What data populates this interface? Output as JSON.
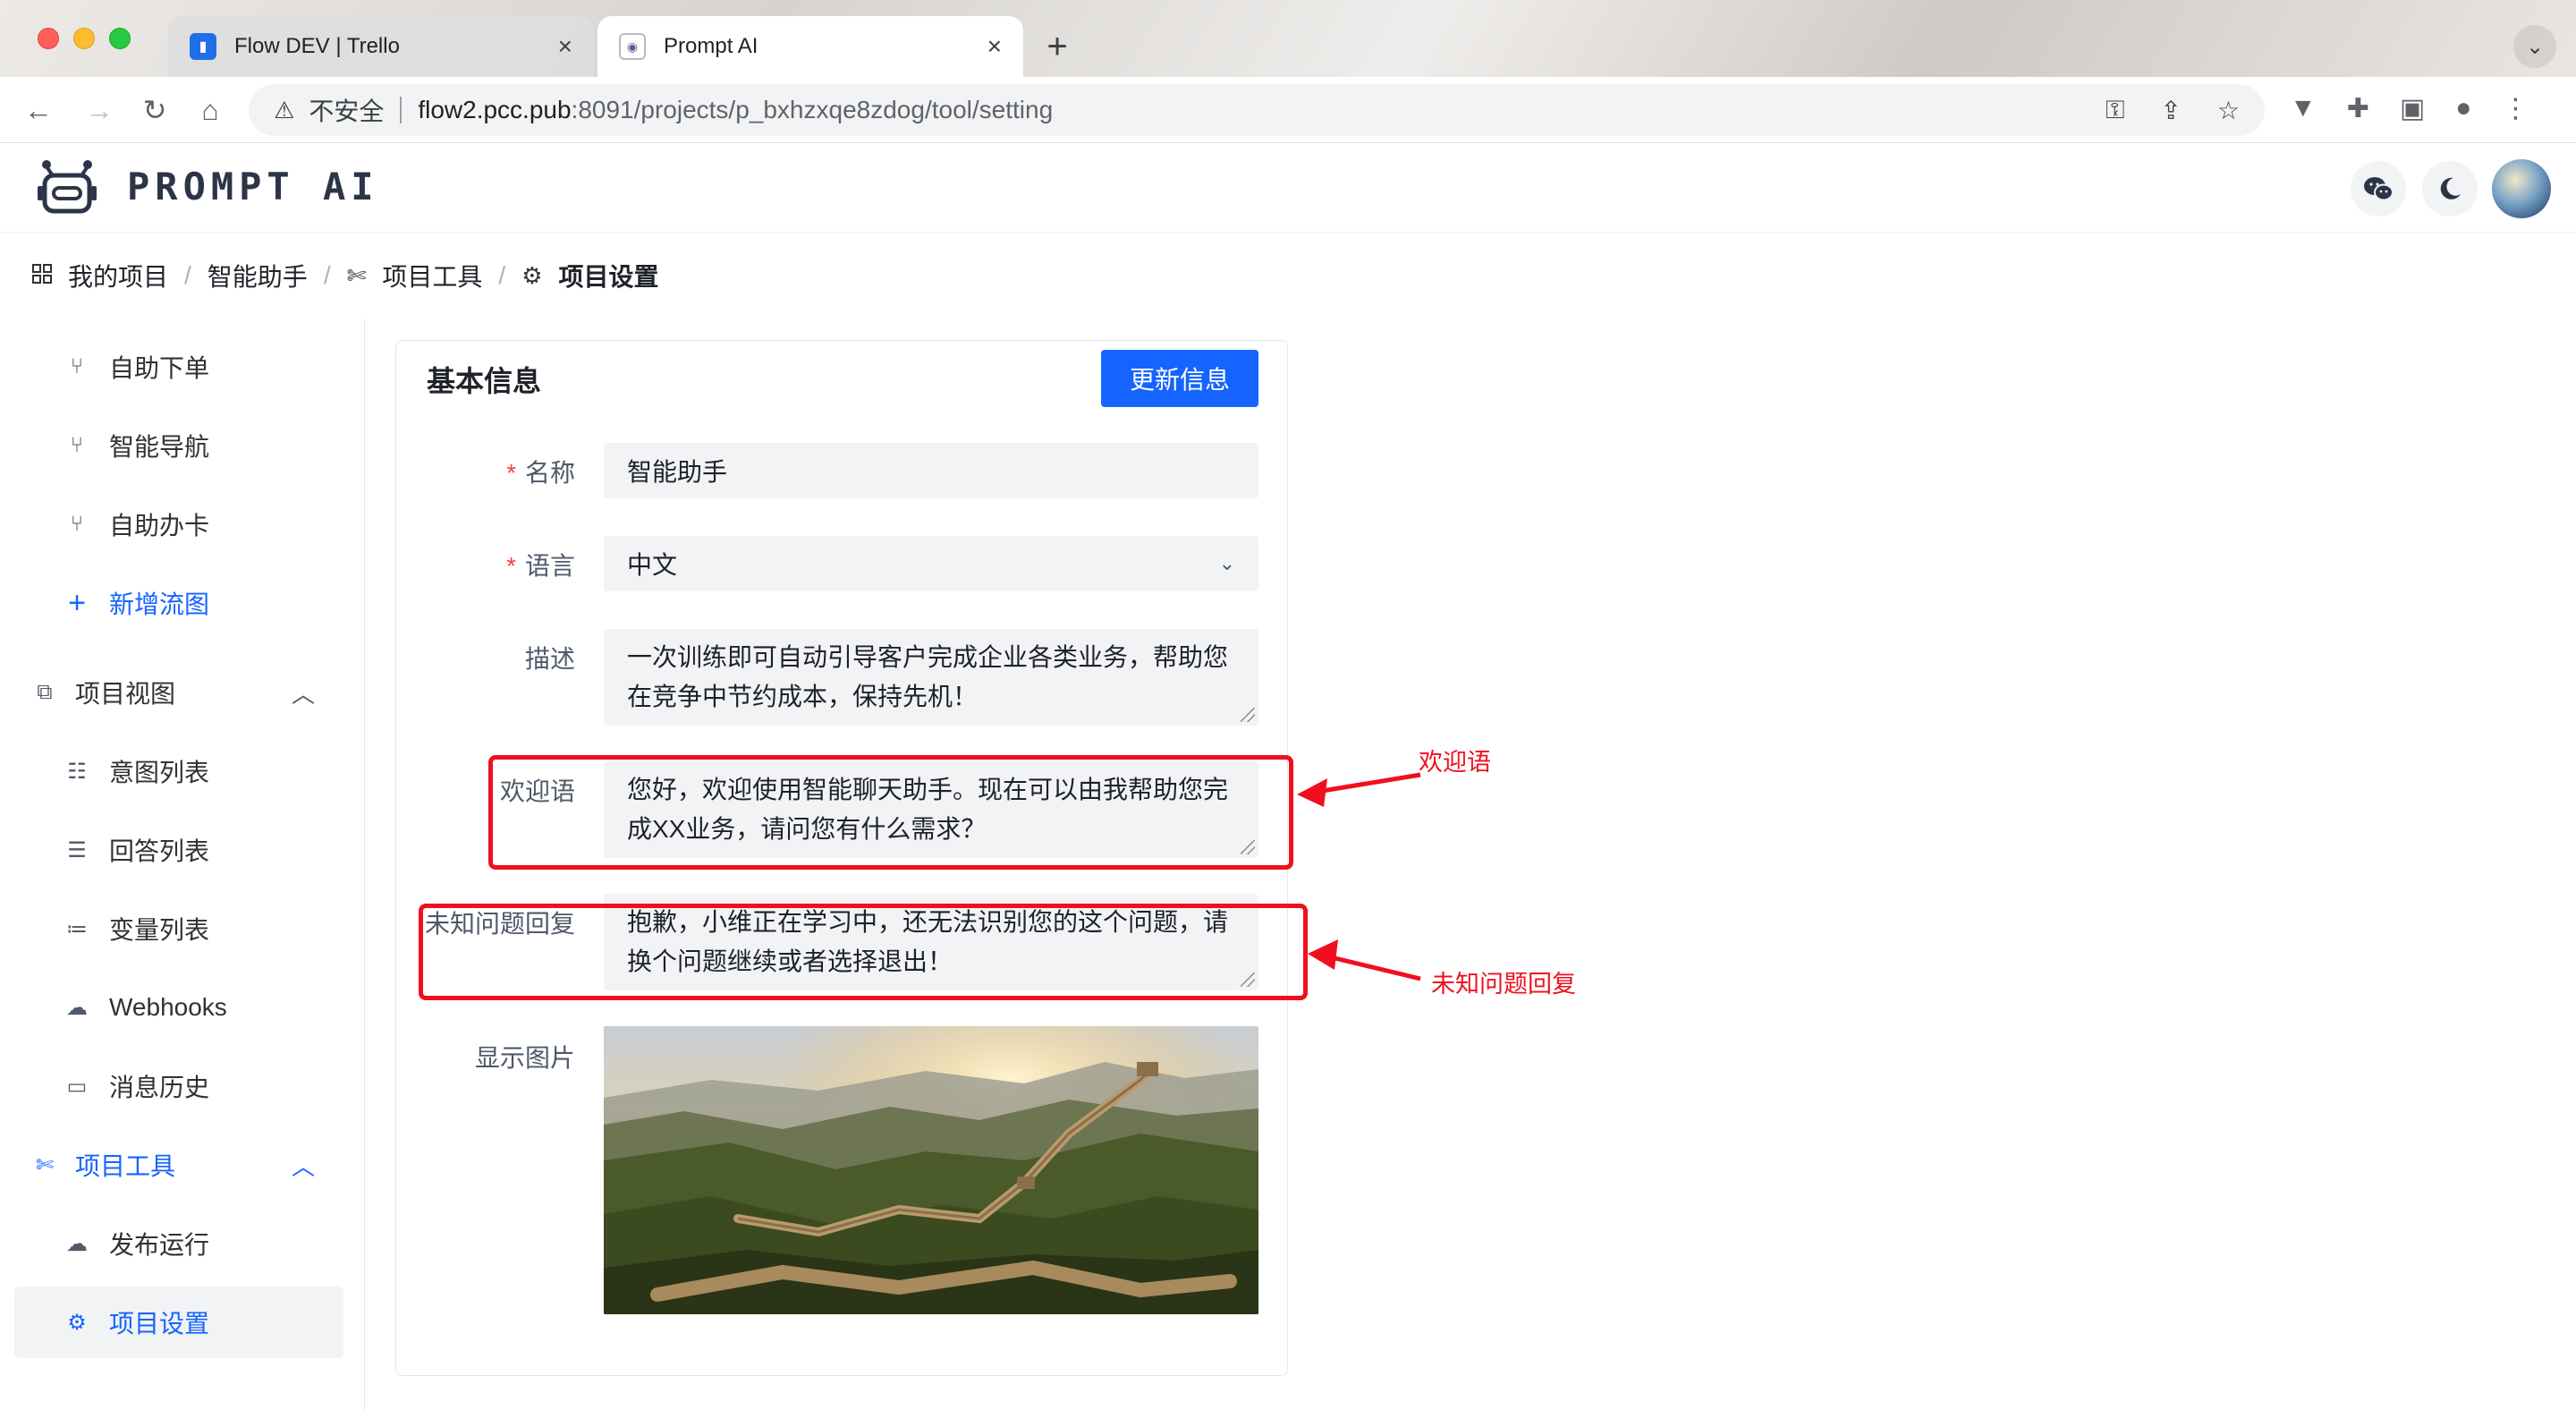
{
  "browser": {
    "tabs": [
      {
        "title": "Flow DEV | Trello",
        "active": false,
        "favicon": "trello-icon"
      },
      {
        "title": "Prompt AI",
        "active": true,
        "favicon": "prompt-ai-icon"
      }
    ],
    "new_tab": "+",
    "tab_menu": "⌄",
    "omnibox": {
      "security_label": "不安全",
      "url_host": "flow2.pcc.pub",
      "url_rest": ":8091/projects/p_bxhzxqe8zdog/tool/setting"
    }
  },
  "app": {
    "logo_text": "PROMPT AI",
    "header_buttons": [
      "wechat-icon",
      "moon-icon"
    ]
  },
  "breadcrumb": [
    {
      "label": "我的项目",
      "icon": "grid-icon"
    },
    {
      "label": "智能助手",
      "icon": ""
    },
    {
      "label": "项目工具",
      "icon": "tools-icon"
    },
    {
      "label": "项目设置",
      "icon": "gear-icon"
    }
  ],
  "sidebar": {
    "items": [
      {
        "label": "自助下单",
        "icon": "branch-icon"
      },
      {
        "label": "智能导航",
        "icon": "branch-icon"
      },
      {
        "label": "自助办卡",
        "icon": "branch-icon"
      },
      {
        "label": "新增流图",
        "icon": "plus-icon"
      },
      {
        "label": "项目视图",
        "icon": "puzzle-icon"
      },
      {
        "label": "意图列表",
        "icon": "list-icon"
      },
      {
        "label": "回答列表",
        "icon": "checklist-icon"
      },
      {
        "label": "变量列表",
        "icon": "bullet-list-icon"
      },
      {
        "label": "Webhooks",
        "icon": "cloud-icon"
      },
      {
        "label": "消息历史",
        "icon": "message-icon"
      },
      {
        "label": "项目工具",
        "icon": "tools-icon"
      },
      {
        "label": "发布运行",
        "icon": "cloud-sync-icon"
      },
      {
        "label": "项目设置",
        "icon": "gear-icon"
      }
    ]
  },
  "card": {
    "title": "基本信息",
    "update_button": "更新信息",
    "fields": {
      "name": {
        "label": "名称",
        "value": "智能助手",
        "required": "*"
      },
      "language": {
        "label": "语言",
        "value": "中文",
        "required": "*"
      },
      "description": {
        "label": "描述",
        "value": "一次训练即可自动引导客户完成企业各类业务，帮助您在竞争中节约成本，保持先机！"
      },
      "welcome": {
        "label": "欢迎语",
        "value": "您好，欢迎使用智能聊天助手。现在可以由我帮助您完成XX业务，请问您有什么需求？"
      },
      "unknown_reply": {
        "label": "未知问题回复",
        "value": "抱歉，小维正在学习中，还无法识别您的这个问题，请换个问题继续或者选择退出！"
      },
      "image": {
        "label": "显示图片"
      }
    }
  },
  "annotations": {
    "welcome": "欢迎语",
    "unknown": "未知问题回复",
    "color": "#f0101d"
  },
  "colors": {
    "primary": "#1664ff",
    "required": "#f53f3f",
    "annotation": "#f0101d"
  }
}
